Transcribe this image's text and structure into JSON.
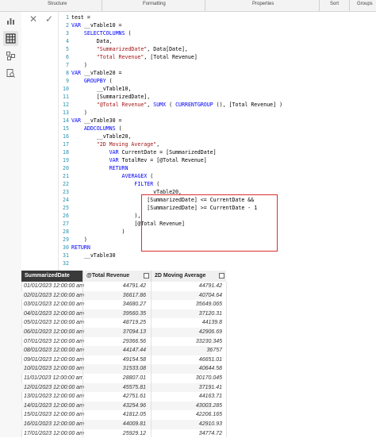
{
  "ribbon": {
    "sections": [
      "Structure",
      "Formatting",
      "Properties",
      "Sort",
      "Groups"
    ]
  },
  "formula_bar": {
    "cancel_glyph": "✕",
    "commit_glyph": "✓"
  },
  "code_lines": [
    "test =",
    "VAR __vTable10 =",
    "    SELECTCOLUMNS (",
    "        Data,",
    "        \"SummarizedDate\", Data[Date],",
    "        \"Total Revenue\", [Total Revenue]",
    "    )",
    "VAR __vTable20 =",
    "    GROUPBY (",
    "        __vTable10,",
    "        [SummarizedDate],",
    "        \"@Total Revenue\", SUMX ( CURRENTGROUP (), [Total Revenue] )",
    "    )",
    "VAR __vTable30 =",
    "    ADDCOLUMNS (",
    "        __vTable20,",
    "        \"2D Moving Average\",",
    "            VAR CurrentDate = [SummarizedDate]",
    "            VAR TotalRev = [@Total Revenue]",
    "            RETURN",
    "                AVERAGEX (",
    "                    FILTER (",
    "                        __vTable20,",
    "                        [SummarizedDate] <= CurrentDate &&",
    "                        [SummarizedDate] >= CurrentDate - 1",
    "                    ),",
    "                    [@Total Revenue]",
    "                )",
    "    )",
    "RETURN",
    "    __vTable30",
    ""
  ],
  "table": {
    "headers": [
      "SummarizedDate",
      "@Total Revenue",
      "2D Moving Average"
    ],
    "rows": [
      [
        "01/01/2023 12:00:00 am",
        "44791.42",
        "44791.42"
      ],
      [
        "02/01/2023 12:00:00 am",
        "36617.86",
        "40704.64"
      ],
      [
        "03/01/2023 12:00:00 am",
        "34680.27",
        "35649.065"
      ],
      [
        "04/01/2023 12:00:00 am",
        "39560.35",
        "37120.31"
      ],
      [
        "05/01/2023 12:00:00 am",
        "48719.25",
        "44139.8"
      ],
      [
        "06/01/2023 12:00:00 am",
        "37094.13",
        "42906.69"
      ],
      [
        "07/01/2023 12:00:00 am",
        "29366.56",
        "33230.345"
      ],
      [
        "08/01/2023 12:00:00 am",
        "44147.44",
        "36757"
      ],
      [
        "09/01/2023 12:00:00 am",
        "49154.58",
        "46651.01"
      ],
      [
        "10/01/2023 12:00:00 am",
        "31533.08",
        "40644.58"
      ],
      [
        "11/01/2023 12:00:00 am",
        "28807.01",
        "30170.045"
      ],
      [
        "12/01/2023 12:00:00 am",
        "45575.81",
        "37191.41"
      ],
      [
        "13/01/2023 12:00:00 am",
        "42751.61",
        "44163.71"
      ],
      [
        "14/01/2023 12:00:00 am",
        "43254.96",
        "43003.285"
      ],
      [
        "15/01/2023 12:00:00 am",
        "41812.05",
        "42206.165"
      ],
      [
        "16/01/2023 12:00:00 am",
        "44009.81",
        "42910.93"
      ],
      [
        "17/01/2023 12:00:00 am",
        "25929.12",
        "34774.72"
      ]
    ]
  }
}
